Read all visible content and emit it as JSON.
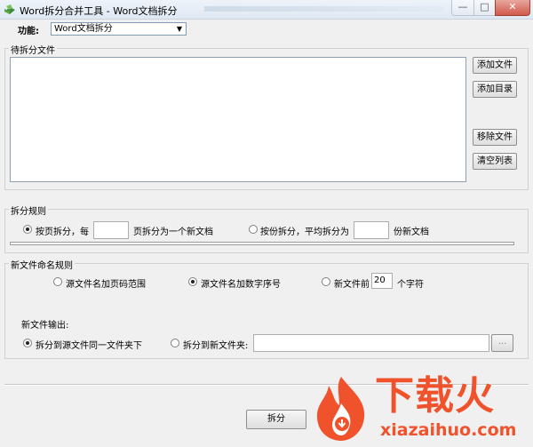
{
  "window": {
    "title": "Word拆分合并工具 - Word文档拆分"
  },
  "function": {
    "label": "功能:",
    "selected": "Word文档拆分"
  },
  "files_group": {
    "title": "待拆分文件",
    "buttons": {
      "add_file": "添加文件",
      "add_dir": "添加目录",
      "remove_file": "移除文件",
      "clear_list": "清空列表"
    }
  },
  "rules_group": {
    "title": "拆分规则",
    "by_page": {
      "label": "按页拆分，每",
      "value": "",
      "suffix": "页拆分为一个新文档",
      "selected": true
    },
    "by_copies": {
      "label": "按份拆分，平均拆分为",
      "value": "",
      "suffix": "份新文档",
      "selected": false
    }
  },
  "naming_group": {
    "title": "新文件命名规则",
    "options": {
      "page_range": {
        "label": "源文件名加页码范围",
        "selected": false
      },
      "number_seq": {
        "label": "源文件名加数字序号",
        "selected": true
      },
      "prefix": {
        "label": "新文件前",
        "value": "20",
        "suffix": "个字符",
        "selected": false
      }
    },
    "output": {
      "title": "新文件输出:",
      "same_folder": {
        "label": "拆分到源文件同一文件夹下",
        "selected": true
      },
      "new_folder": {
        "label": "拆分到新文件夹:",
        "value": "",
        "browse": "...",
        "selected": false
      }
    }
  },
  "split_button": "拆分",
  "watermark": {
    "brand": "下载火",
    "url": "xiazaihuo.com"
  },
  "colors": {
    "watermark_orange": "#f0522c"
  }
}
